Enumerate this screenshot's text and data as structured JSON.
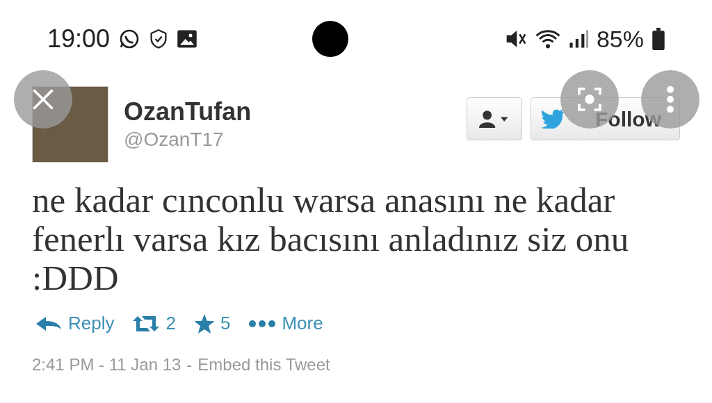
{
  "status_bar": {
    "time": "19:00",
    "battery": "85%"
  },
  "tweet": {
    "name": "OzanTufan",
    "handle": "@OzanT17",
    "follow_label": "Follow",
    "text": "ne kadar cınconlu warsa anasını ne kadar fenerlı varsa kız bacısını anladınız siz onu :DDD",
    "actions": [
      {
        "kind": "reply",
        "label": "Reply"
      },
      {
        "kind": "retweet",
        "label": "2"
      },
      {
        "kind": "favorite",
        "label": "5"
      },
      {
        "kind": "more",
        "label": "More"
      }
    ],
    "timestamp": "2:41 PM - 11 Jan 13",
    "separator": "-",
    "embed_label": "Embed this Tweet"
  }
}
